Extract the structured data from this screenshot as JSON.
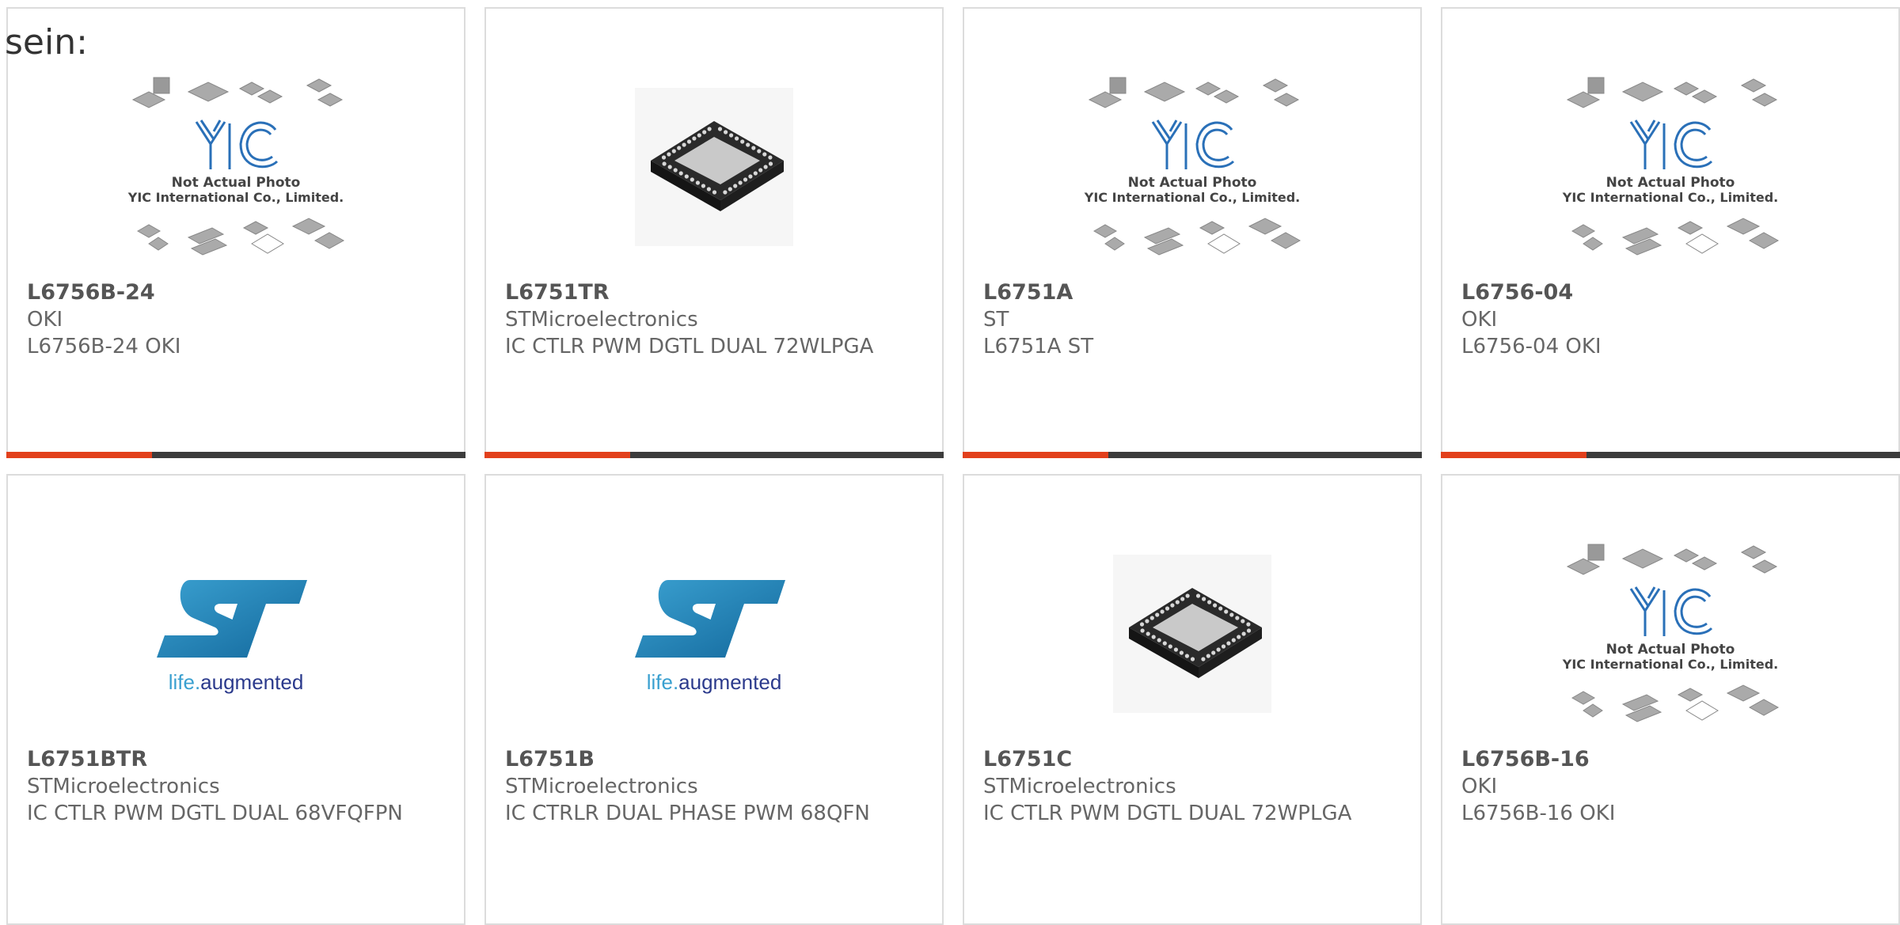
{
  "page": {
    "prefix_text": "sein:"
  },
  "colors": {
    "accent": "#e2401c",
    "bar_dark": "#3c3c3c",
    "card_border": "#dcdcdc",
    "st_blue": "#1f7fb4"
  },
  "placeholder_image": {
    "logo_text": "YIC",
    "line1": "Not Actual Photo",
    "line2": "YIC International Co., Limited."
  },
  "st_logo": {
    "mark": "ST",
    "tagline_life": "life.",
    "tagline_aug": "augmented"
  },
  "products": [
    {
      "part_number": "L6756B-24",
      "manufacturer": "OKI",
      "description": "L6756B-24 OKI",
      "image": "yic-placeholder"
    },
    {
      "part_number": "L6751TR",
      "manufacturer": "STMicroelectronics",
      "description": "IC CTLR PWM DGTL DUAL 72WLPGA",
      "image": "chip-photo"
    },
    {
      "part_number": "L6751A",
      "manufacturer": "ST",
      "description": "L6751A ST",
      "image": "yic-placeholder"
    },
    {
      "part_number": "L6756-04",
      "manufacturer": "OKI",
      "description": "L6756-04 OKI",
      "image": "yic-placeholder"
    },
    {
      "part_number": "L6751BTR",
      "manufacturer": "STMicroelectronics",
      "description": "IC CTLR PWM DGTL DUAL 68VFQFPN",
      "image": "st-logo"
    },
    {
      "part_number": "L6751B",
      "manufacturer": "STMicroelectronics",
      "description": "IC CTRLR DUAL PHASE PWM 68QFN",
      "image": "st-logo"
    },
    {
      "part_number": "L6751C",
      "manufacturer": "STMicroelectronics",
      "description": "IC CTLR PWM DGTL DUAL 72WPLGA",
      "image": "chip-photo"
    },
    {
      "part_number": "L6756B-16",
      "manufacturer": "OKI",
      "description": "L6756B-16 OKI",
      "image": "yic-placeholder"
    }
  ]
}
